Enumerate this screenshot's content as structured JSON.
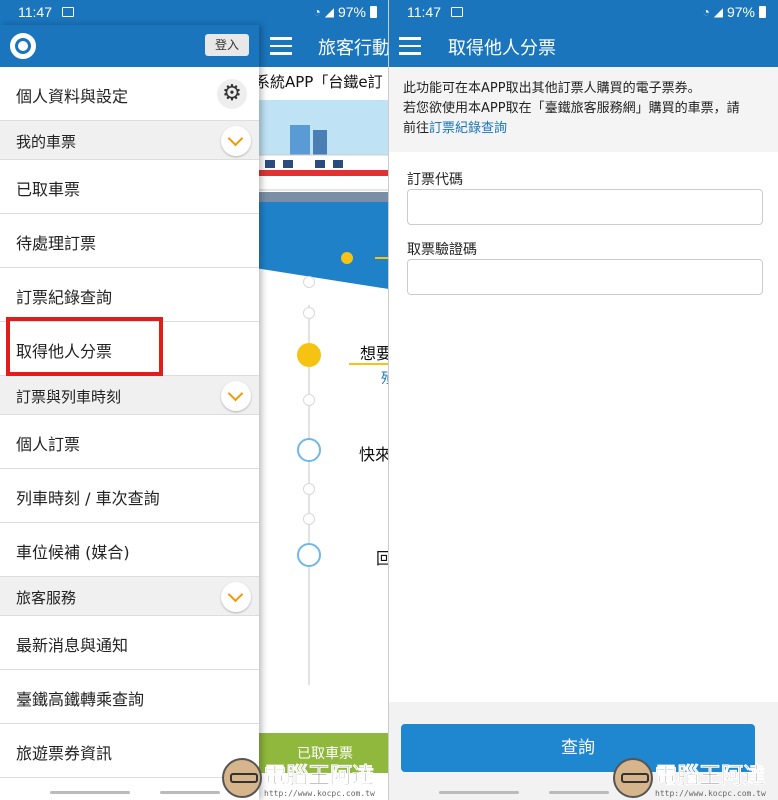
{
  "status_bar": {
    "time": "11:47",
    "battery": "97%"
  },
  "left_phone": {
    "main_title": "旅客行動",
    "marquee": "系統APP「台鐵e訂",
    "timeline": [
      "想要",
      "快來",
      "回"
    ],
    "timeline_sub": "殞",
    "bottom_tab": "已取車票",
    "drawer": {
      "login": "登入",
      "profile": "個人資料與設定",
      "sections": [
        {
          "title": "我的車票",
          "items": [
            "已取車票",
            "待處理訂票",
            "訂票紀錄查詢",
            "取得他人分票"
          ]
        },
        {
          "title": "訂票與列車時刻",
          "items": [
            "個人訂票",
            "列車時刻 / 車次查詢",
            "車位候補 (媒合)"
          ]
        },
        {
          "title": "旅客服務",
          "items": [
            "最新消息與通知",
            "臺鐵高鐵轉乘查詢",
            "旅遊票券資訊"
          ]
        }
      ]
    }
  },
  "right_phone": {
    "title": "取得他人分票",
    "info_line1": "此功能可在本APP取出其他訂票人購買的電子票券。",
    "info_line2": "若您欲使用本APP取在「臺鐵旅客服務網」購買的車票，請",
    "info_line3_prefix": "前往",
    "info_link": "訂票紀錄查詢",
    "field1_label": "訂票代碼",
    "field2_label": "取票驗證碼",
    "submit": "查詢"
  },
  "watermark": {
    "text": "電腦王阿達",
    "url": "http://www.kocpc.com.tw"
  },
  "colors": {
    "primary": "#1a75bc",
    "accent": "#f29a00",
    "highlight": "#e31b1b",
    "green": "#8fb83c"
  }
}
